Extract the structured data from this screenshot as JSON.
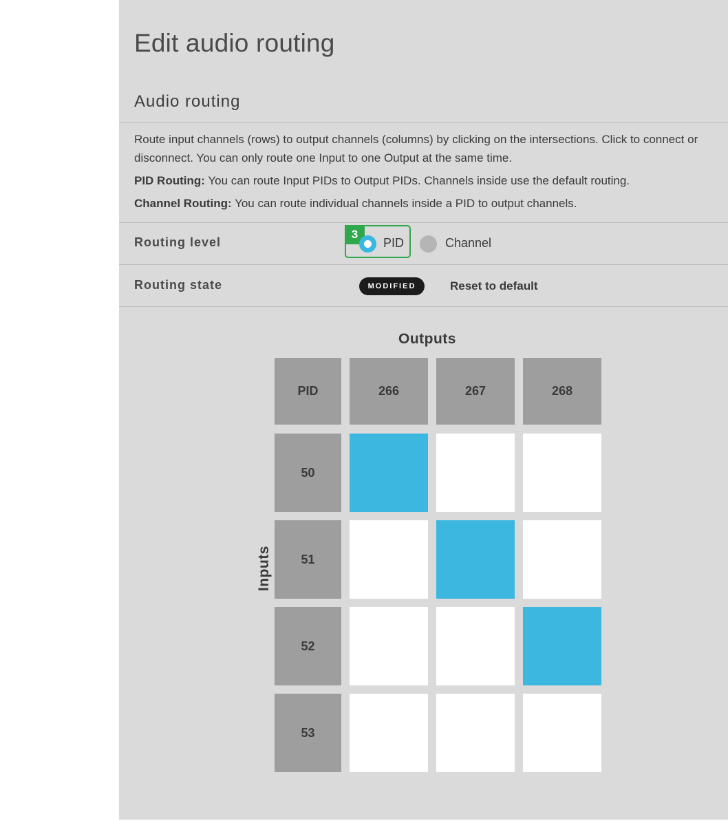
{
  "header": {
    "title": "Edit audio routing"
  },
  "section": {
    "title": "Audio routing",
    "description": "Route input channels (rows) to output channels (columns) by clicking on the intersections. Click to connect or disconnect. You can only route one Input to one Output at the same time.",
    "pid_routing_label": "PID Routing:",
    "pid_routing_text": " You can route Input PIDs to Output PIDs. Channels inside use the default routing.",
    "channel_routing_label": "Channel Routing:",
    "channel_routing_text": " You can route individual channels inside a PID to output channels."
  },
  "routing_level": {
    "label": "Routing level",
    "marker": "3",
    "options": [
      {
        "label": "PID",
        "selected": true
      },
      {
        "label": "Channel",
        "selected": false
      }
    ]
  },
  "routing_state": {
    "label": "Routing state",
    "badge": "MODIFIED",
    "reset_label": "Reset to default"
  },
  "matrix": {
    "outputs_label": "Outputs",
    "inputs_label": "Inputs",
    "corner_label": "PID",
    "outputs": [
      "266",
      "267",
      "268"
    ],
    "inputs": [
      "50",
      "51",
      "52",
      "53"
    ],
    "connections": [
      [
        true,
        false,
        false
      ],
      [
        false,
        true,
        false
      ],
      [
        false,
        false,
        true
      ],
      [
        false,
        false,
        false
      ]
    ]
  },
  "colors": {
    "panel_bg": "#dadada",
    "header_cell": "#9e9e9e",
    "active_cell": "#3cb8e0",
    "focus_outline": "#2ea84a",
    "badge_bg": "#1c1c1c"
  }
}
